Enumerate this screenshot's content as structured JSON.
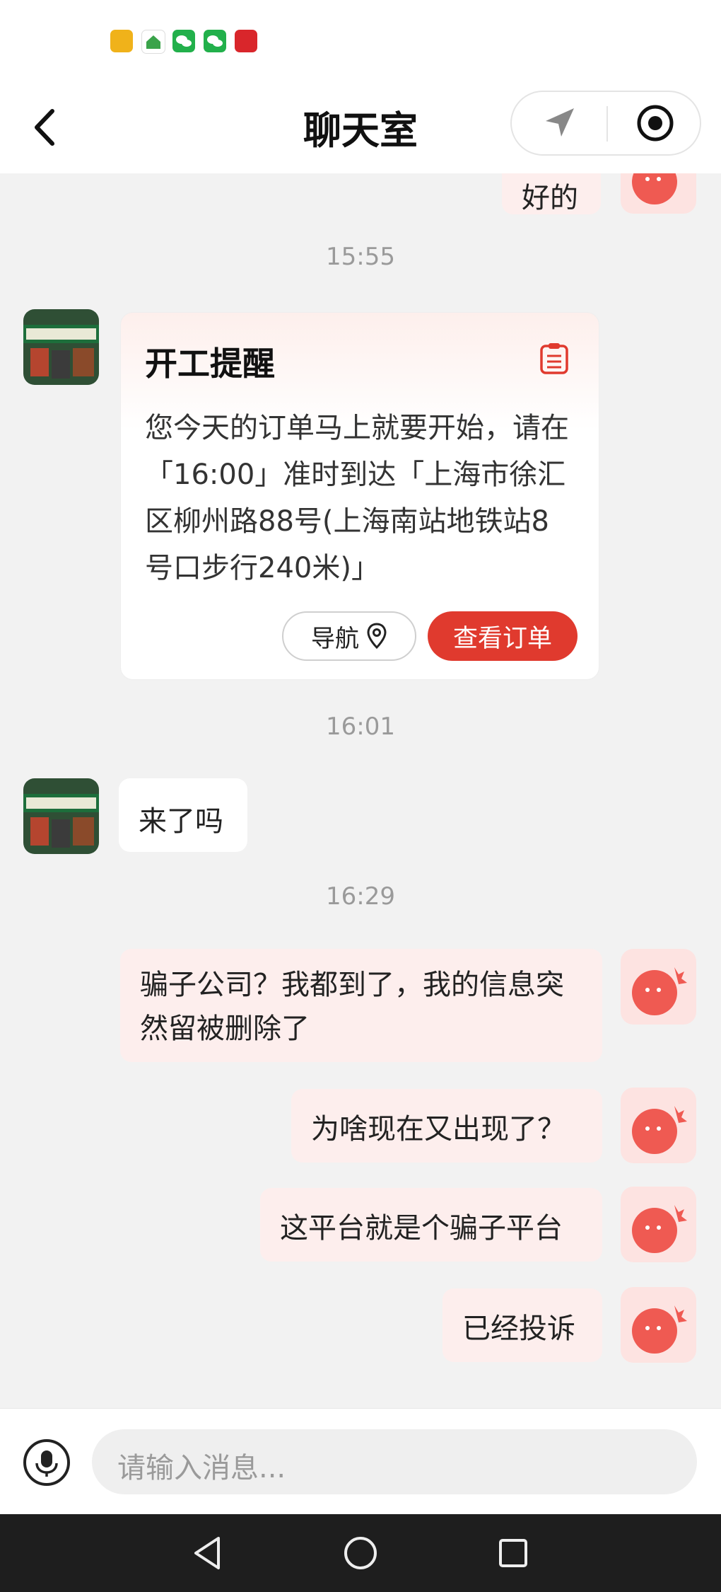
{
  "header": {
    "title": "聊天室"
  },
  "chat": {
    "prev_reply": "好的",
    "card": {
      "time": "15:55",
      "title": "开工提醒",
      "body": "您今天的订单马上就要开始，请在「16:00」准时到达「上海市徐汇区柳州路88号(上海南站地铁站8号口步行240米)」",
      "nav_label": "导航",
      "order_label": "查看订单"
    },
    "time_2": "16:01",
    "msg_shop": "来了吗",
    "time_3": "16:29",
    "my_messages": [
      "骗子公司？我都到了，我的信息突然留被删除了",
      "为啥现在又出现了？",
      "这平台就是个骗子平台",
      "已经投诉"
    ]
  },
  "input": {
    "placeholder": "请输入消息..."
  },
  "colors": {
    "accent": "#e03a2e",
    "my_bubble": "#fdeeed",
    "background": "#f2f2f2"
  }
}
